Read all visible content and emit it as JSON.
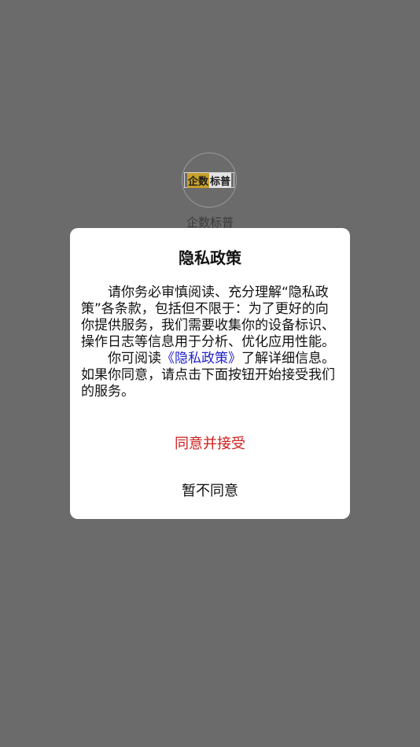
{
  "splash": {
    "logo_text_part1": "企数",
    "logo_text_part2": "标普",
    "app_name": "企数标普"
  },
  "dialog": {
    "title": "隐私政策",
    "paragraph1": "请你务必审慎阅读、充分理解“隐私政策”各条款，包括但不限于：为了更好的向你提供服务，我们需要收集你的设备标识、操作日志等信息用于分析、优化应用性能。",
    "paragraph2_before": "你可阅读",
    "policy_link": "《隐私政策》",
    "paragraph2_after": "了解详细信息。如果你同意，请点击下面按钮开始接受我们的服务。",
    "agree_label": "同意并接受",
    "decline_label": "暂不同意"
  },
  "colors": {
    "overlay": "#6b6b6b",
    "agree": "#d01b1b",
    "link": "#2222cc"
  }
}
